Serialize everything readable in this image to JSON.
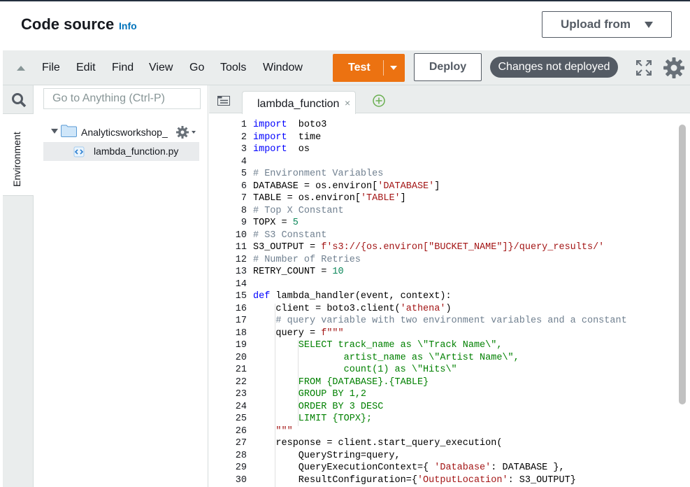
{
  "header": {
    "title": "Code source",
    "info": "Info",
    "upload_label": "Upload from"
  },
  "menubar": {
    "items": [
      "File",
      "Edit",
      "Find",
      "View",
      "Go",
      "Tools",
      "Window"
    ],
    "test_label": "Test",
    "deploy_label": "Deploy",
    "status": "Changes not deployed"
  },
  "sidebar": {
    "environment_tab": "Environment"
  },
  "filetree": {
    "search_placeholder": "Go to Anything (Ctrl-P)",
    "folder": "Analyticsworkshop_",
    "file": "lambda_function.py"
  },
  "editor": {
    "tab_label": "lambda_function",
    "tab_close": "×",
    "lines": [
      {
        "n": "1",
        "parts": [
          [
            "kw",
            "import"
          ],
          [
            "",
            "  boto3"
          ]
        ]
      },
      {
        "n": "2",
        "parts": [
          [
            "kw",
            "import"
          ],
          [
            "",
            "  time"
          ]
        ]
      },
      {
        "n": "3",
        "parts": [
          [
            "kw",
            "import"
          ],
          [
            "",
            "  os"
          ]
        ]
      },
      {
        "n": "4",
        "parts": []
      },
      {
        "n": "5",
        "parts": [
          [
            "cm",
            "# Environment Variables"
          ]
        ]
      },
      {
        "n": "6",
        "parts": [
          [
            "",
            "DATABASE = os.environ["
          ],
          [
            "str",
            "'DATABASE'"
          ],
          [
            "",
            "]"
          ]
        ]
      },
      {
        "n": "7",
        "parts": [
          [
            "",
            "TABLE = os.environ["
          ],
          [
            "str",
            "'TABLE'"
          ],
          [
            "",
            "]"
          ]
        ]
      },
      {
        "n": "8",
        "parts": [
          [
            "cm",
            "# Top X Constant"
          ]
        ]
      },
      {
        "n": "9",
        "parts": [
          [
            "",
            "TOPX = "
          ],
          [
            "num",
            "5"
          ]
        ]
      },
      {
        "n": "10",
        "parts": [
          [
            "cm",
            "# S3 Constant"
          ]
        ]
      },
      {
        "n": "11",
        "parts": [
          [
            "",
            "S3_OUTPUT = "
          ],
          [
            "str",
            "f's3://{os.environ[\"BUCKET_NAME\"]}/query_results/'"
          ]
        ]
      },
      {
        "n": "12",
        "parts": [
          [
            "cm",
            "# Number of Retries"
          ]
        ]
      },
      {
        "n": "13",
        "parts": [
          [
            "",
            "RETRY_COUNT = "
          ],
          [
            "num",
            "10"
          ]
        ]
      },
      {
        "n": "14",
        "parts": []
      },
      {
        "n": "15",
        "parts": [
          [
            "kw",
            "def"
          ],
          [
            "",
            " lambda_handler(event, context):"
          ]
        ]
      },
      {
        "n": "16",
        "parts": [
          [
            "",
            "    client = boto3.client("
          ],
          [
            "str",
            "'athena'"
          ],
          [
            "",
            ")"
          ]
        ]
      },
      {
        "n": "17",
        "parts": [
          [
            "cm",
            "    # query variable with two environment variables and a constant"
          ]
        ]
      },
      {
        "n": "18",
        "parts": [
          [
            "",
            "    query = "
          ],
          [
            "str",
            "f\"\"\""
          ]
        ]
      },
      {
        "n": "19",
        "parts": [
          [
            "sql",
            "        SELECT track_name as \\\"Track Name\\\","
          ]
        ]
      },
      {
        "n": "20",
        "parts": [
          [
            "sql",
            "                artist_name as \\\"Artist Name\\\","
          ]
        ]
      },
      {
        "n": "21",
        "parts": [
          [
            "sql",
            "                count(1) as \\\"Hits\\\""
          ]
        ]
      },
      {
        "n": "22",
        "parts": [
          [
            "sql",
            "        FROM {DATABASE}.{TABLE}"
          ]
        ]
      },
      {
        "n": "23",
        "parts": [
          [
            "sql",
            "        GROUP BY 1,2"
          ]
        ]
      },
      {
        "n": "24",
        "parts": [
          [
            "sql",
            "        ORDER BY 3 DESC"
          ]
        ]
      },
      {
        "n": "25",
        "parts": [
          [
            "sql",
            "        LIMIT {TOPX};"
          ]
        ]
      },
      {
        "n": "26",
        "parts": [
          [
            "str",
            "    \"\"\""
          ]
        ]
      },
      {
        "n": "27",
        "parts": [
          [
            "",
            "    response = client.start_query_execution("
          ]
        ]
      },
      {
        "n": "28",
        "parts": [
          [
            "",
            "        QueryString=query,"
          ]
        ]
      },
      {
        "n": "29",
        "parts": [
          [
            "",
            "        QueryExecutionContext={ "
          ],
          [
            "str",
            "'Database'"
          ],
          [
            "",
            ": DATABASE },"
          ]
        ]
      },
      {
        "n": "30",
        "parts": [
          [
            "",
            "        ResultConfiguration={"
          ],
          [
            "str",
            "'OutputLocation'"
          ],
          [
            "",
            ": S3_OUTPUT}"
          ]
        ]
      }
    ]
  }
}
